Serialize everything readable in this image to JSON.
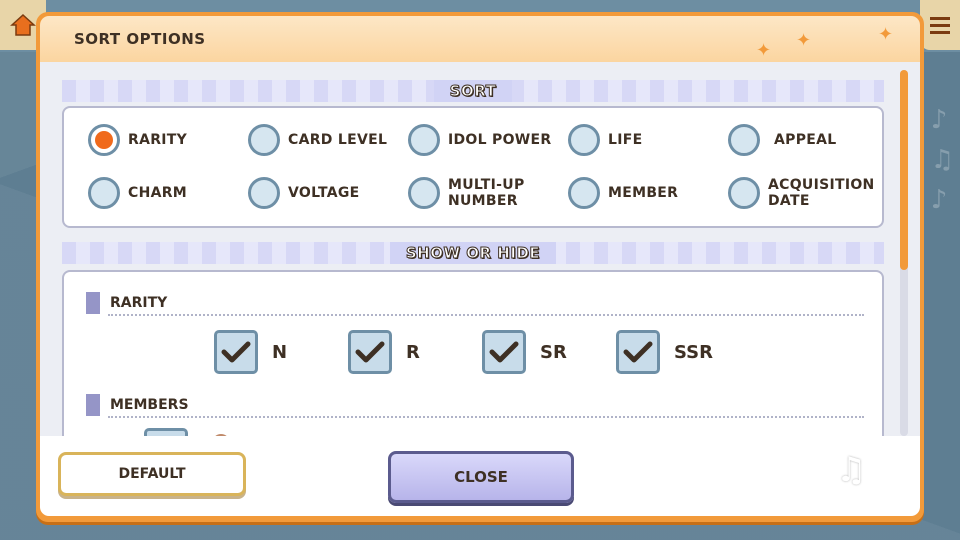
{
  "dialog": {
    "title": "SORT OPTIONS"
  },
  "sort_section": {
    "title": "SORT",
    "options": [
      {
        "label": "RARITY",
        "selected": true
      },
      {
        "label": "CARD LEVEL",
        "selected": false
      },
      {
        "label": "IDOL POWER",
        "selected": false
      },
      {
        "label": "LIFE",
        "selected": false
      },
      {
        "label": "APPEAL",
        "selected": false
      },
      {
        "label": "CHARM",
        "selected": false
      },
      {
        "label": "VOLTAGE",
        "selected": false
      },
      {
        "label": "MULTI-UP\nNUMBER",
        "selected": false
      },
      {
        "label": "MEMBER",
        "selected": false
      },
      {
        "label": "ACQUISITION\nDATE",
        "selected": false
      }
    ]
  },
  "show_hide_section": {
    "title": "SHOW OR HIDE",
    "rarity_group": {
      "label": "RARITY",
      "items": [
        {
          "label": "N",
          "checked": true
        },
        {
          "label": "R",
          "checked": true
        },
        {
          "label": "SR",
          "checked": true
        },
        {
          "label": "SSR",
          "checked": true
        }
      ]
    },
    "members_group": {
      "label": "MEMBERS"
    }
  },
  "buttons": {
    "default_label": "DEFAULT",
    "close_label": "CLOSE"
  },
  "colors": {
    "accent_orange": "#f29a3a",
    "radio_selected": "#f06a1c",
    "section_lavender": "#d1d3f5"
  }
}
